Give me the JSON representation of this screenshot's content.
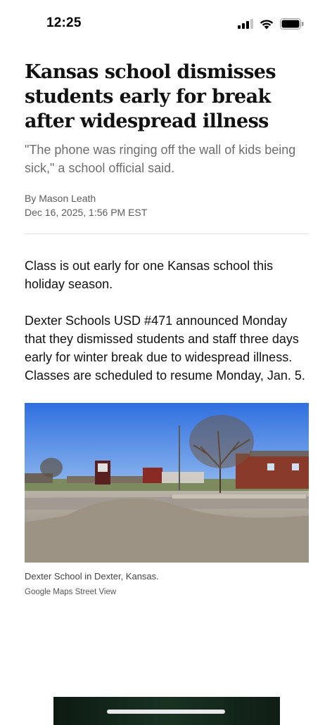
{
  "status_bar": {
    "time": "12:25",
    "icons": [
      "signal-icon",
      "wifi-icon",
      "battery-icon"
    ]
  },
  "article": {
    "headline": "Kansas school dismisses students early for break after widespread illness",
    "dek": "\"The phone was ringing off the wall of kids being sick,\" a school official said.",
    "byline": "By Mason Leath",
    "dateline": "Dec 16, 2025, 1:56 PM EST",
    "paragraphs": [
      "Class is out early for one Kansas school this holiday season.",
      "Dexter Schools USD #471 announced Monday that they dismissed students and staff three days early for winter break due to widespread illness. Classes are scheduled to resume Monday, Jan. 5."
    ],
    "image": {
      "caption": "Dexter School in Dexter, Kansas.",
      "credit": "Google Maps Street View"
    }
  },
  "colors": {
    "background": "#ffffff",
    "text": "#111111",
    "muted": "#6d6d6d",
    "divider": "#e2e2e2",
    "sky": "#3f7ae0",
    "brick": "#8a3a2a"
  }
}
